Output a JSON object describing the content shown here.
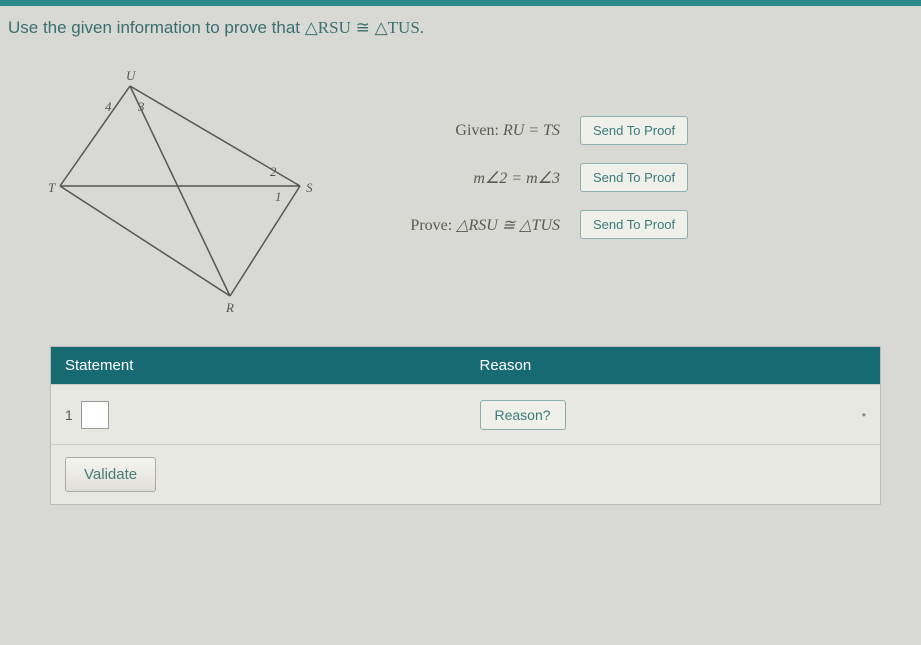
{
  "prompt": {
    "lead": "Use the given information to prove that ",
    "tri1": "△RSU",
    "congruent": " ≅ ",
    "tri2": "△TUS."
  },
  "diagram": {
    "vertices": {
      "U": "U",
      "T": "T",
      "S": "S",
      "R": "R"
    },
    "angles": {
      "a1": "1",
      "a2": "2",
      "a3": "3",
      "a4": "4"
    }
  },
  "given": {
    "label1_lead": "Given: ",
    "label1_expr": "RU = TS",
    "label2_expr": "m∠2 = m∠3",
    "prove_lead": "Prove: ",
    "prove_expr": "△RSU ≅ △TUS",
    "send_btn": "Send To Proof"
  },
  "table": {
    "header_statement": "Statement",
    "header_reason": "Reason",
    "row1_num": "1",
    "reason_btn": "Reason?",
    "validate": "Validate"
  }
}
